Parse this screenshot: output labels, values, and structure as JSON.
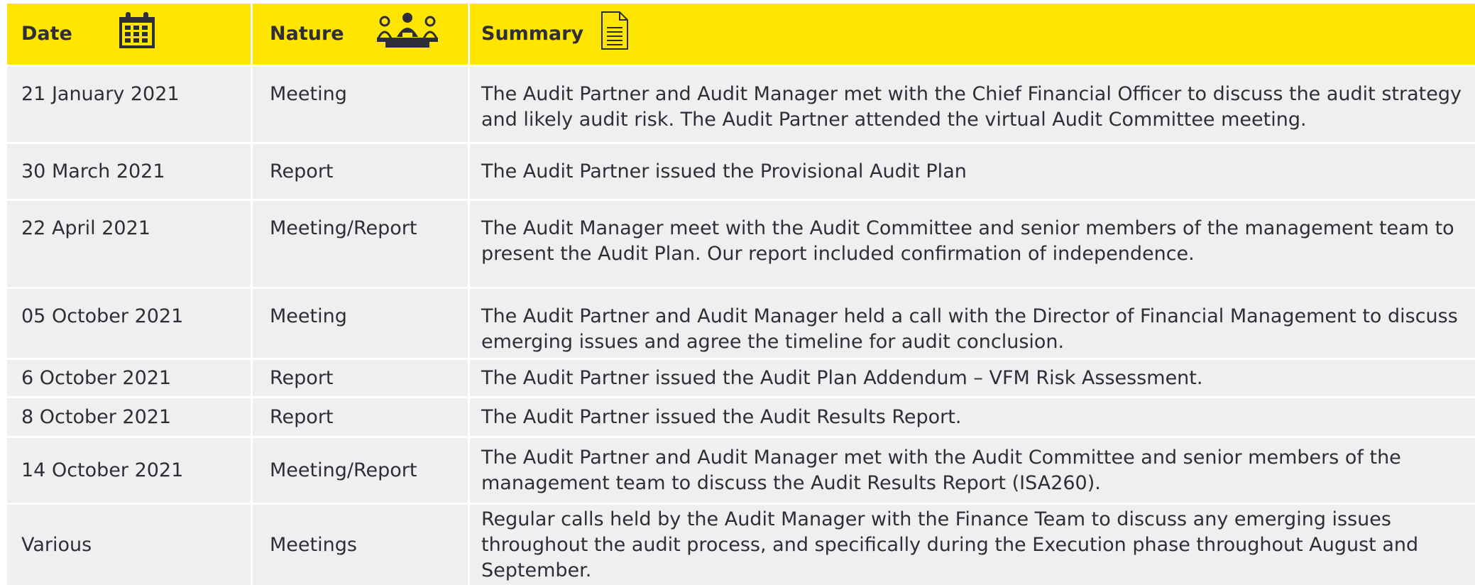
{
  "header": {
    "date_label": "Date",
    "date_icon": "calendar-icon",
    "nature_label": "Nature",
    "nature_icon": "meeting-icon",
    "summary_label": "Summary",
    "summary_icon": "document-icon"
  },
  "colors": {
    "header_bg": "#ffe600",
    "row_bg": "#efefef",
    "text": "#2e2e38"
  },
  "rows": [
    {
      "date": "21 January 2021",
      "nature": "Meeting",
      "summary": [
        "The Audit Partner and Audit Manager met with the Chief Financial Officer to discuss the audit strategy",
        "and likely audit risk. The Audit Partner attended the virtual Audit Committee meeting."
      ]
    },
    {
      "date": "30 March 2021",
      "nature": "Report",
      "summary": [
        "The Audit Partner issued the Provisional Audit Plan"
      ]
    },
    {
      "date": "22 April 2021",
      "nature": "Meeting/Report",
      "summary": [
        "The Audit Manager meet with the Audit Committee and senior members of the management team to",
        "present the Audit Plan. Our report included confirmation of independence."
      ]
    },
    {
      "date": "05 October 2021",
      "nature": "Meeting",
      "summary": [
        "The Audit Partner and Audit Manager held a call with the Director of Financial Management to discuss",
        "emerging issues and agree the timeline for audit conclusion."
      ]
    },
    {
      "date": "6 October 2021",
      "nature": "Report",
      "summary": [
        "The Audit Partner issued the Audit Plan Addendum – VFM Risk Assessment."
      ]
    },
    {
      "date": "8 October 2021",
      "nature": "Report",
      "summary": [
        "The Audit Partner issued the Audit Results Report."
      ]
    },
    {
      "date": "14 October 2021",
      "nature": "Meeting/Report",
      "summary": [
        "The Audit Partner and Audit Manager met with the Audit Committee and senior members of the",
        "management team to discuss the Audit Results Report (ISA260)."
      ]
    },
    {
      "date": "Various",
      "nature": "Meetings",
      "summary": [
        "Regular calls held by the Audit Manager with the Finance Team to discuss any emerging issues",
        "throughout the audit process, and specifically during the Execution phase throughout August and",
        "September."
      ]
    }
  ]
}
